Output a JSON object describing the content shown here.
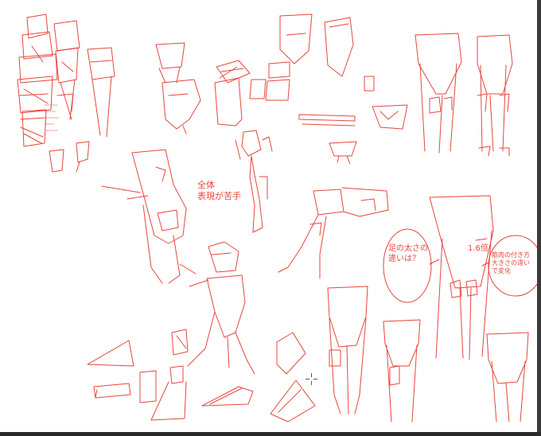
{
  "canvas": {
    "background": "#ffffff",
    "stroke_color": "#e8453c"
  },
  "annotations": {
    "note_hard": "全体\n表現が苦手",
    "note_thigh": "足の太さの\n違いは？",
    "note_ratio": "1.6倍",
    "note_muscle": "筋肉の付き方\n大きさの違い\nで変化"
  },
  "cursor": {
    "icon": "crosshair-cursor-icon"
  }
}
